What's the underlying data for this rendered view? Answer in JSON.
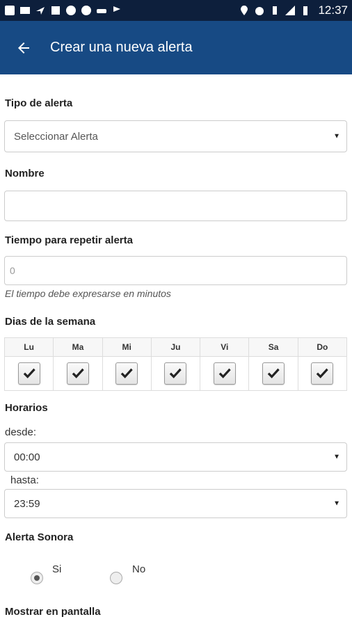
{
  "status_bar": {
    "time": "12:37",
    "left_icons": [
      "facebook-icon",
      "mail-icon",
      "plane-icon",
      "photo-icon",
      "whatsapp-icon",
      "circle-icon",
      "car-icon",
      "flag-icon"
    ],
    "right_icons": [
      "location-icon",
      "alarm-icon",
      "vibrate-icon",
      "signal-icon",
      "battery-icon"
    ]
  },
  "app_bar": {
    "title": "Crear una nueva alerta"
  },
  "form": {
    "alert_type": {
      "label": "Tipo de alerta",
      "value": "Seleccionar Alerta"
    },
    "name": {
      "label": "Nombre",
      "value": ""
    },
    "repeat": {
      "label": "Tiempo para repetir alerta",
      "placeholder": "0",
      "helper": "El tiempo debe expresarse en minutos"
    },
    "days": {
      "label": "Dias de la semana",
      "items": [
        {
          "name": "Lu",
          "checked": true
        },
        {
          "name": "Ma",
          "checked": true
        },
        {
          "name": "Mi",
          "checked": true
        },
        {
          "name": "Ju",
          "checked": true
        },
        {
          "name": "Vi",
          "checked": true
        },
        {
          "name": "Sa",
          "checked": true
        },
        {
          "name": "Do",
          "checked": true
        }
      ]
    },
    "schedule": {
      "label": "Horarios",
      "from_label": "desde:",
      "from_value": "00:00",
      "to_label": "hasta:",
      "to_value": "23:59"
    },
    "sound": {
      "label": "Alerta Sonora",
      "options": [
        "Si",
        "No"
      ],
      "selected": "Si"
    },
    "display": {
      "label": "Mostrar en pantalla"
    }
  }
}
